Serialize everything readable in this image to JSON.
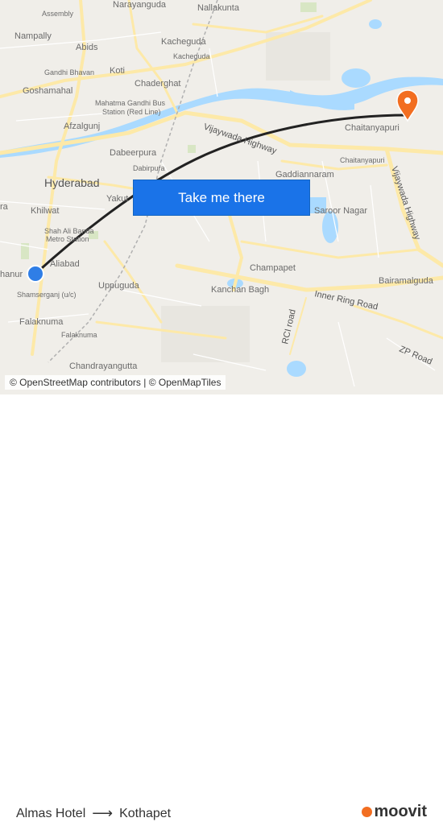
{
  "map": {
    "places": [
      {
        "name": "Assembly",
        "size": "sm"
      },
      {
        "name": "Narayanguda",
        "size": "md"
      },
      {
        "name": "Nallakunta",
        "size": "md"
      },
      {
        "name": "Nampally",
        "size": "md"
      },
      {
        "name": "Abids",
        "size": "md"
      },
      {
        "name": "Kacheguda",
        "size": "md"
      },
      {
        "name": "Kacheguda",
        "size": "sm"
      },
      {
        "name": "Gandhi Bhavan",
        "size": "sm"
      },
      {
        "name": "Koti",
        "size": "md"
      },
      {
        "name": "Goshamahal",
        "size": "md"
      },
      {
        "name": "Chaderghat",
        "size": "md"
      },
      {
        "name": "Mahatma Gandhi Bus",
        "size": "sm"
      },
      {
        "name": "Station (Red Line)",
        "size": "sm"
      },
      {
        "name": "Afzalgunj",
        "size": "md"
      },
      {
        "name": "Chaitanyapuri",
        "size": "md"
      },
      {
        "name": "Chaitanyapuri",
        "size": "sm"
      },
      {
        "name": "Dabeerpura",
        "size": "md"
      },
      {
        "name": "Dabirpura",
        "size": "sm"
      },
      {
        "name": "Gaddiannaram",
        "size": "md"
      },
      {
        "name": "Hyderabad",
        "size": "big"
      },
      {
        "name": "Yakut",
        "size": "md"
      },
      {
        "name": "ra",
        "size": "md"
      },
      {
        "name": "Khilwat",
        "size": "md"
      },
      {
        "name": "Saroor Nagar",
        "size": "md"
      },
      {
        "name": "Shah Ali Banda",
        "size": "sm"
      },
      {
        "name": "Metro Station",
        "size": "sm"
      },
      {
        "name": "Aliabad",
        "size": "md"
      },
      {
        "name": "hanur",
        "size": "md"
      },
      {
        "name": "Champapet",
        "size": "md"
      },
      {
        "name": "Uppuguda",
        "size": "md"
      },
      {
        "name": "Kanchan Bagh",
        "size": "md"
      },
      {
        "name": "Bairamalguda",
        "size": "md"
      },
      {
        "name": "Shamserganj (u/c)",
        "size": "sm"
      },
      {
        "name": "Falaknuma",
        "size": "md"
      },
      {
        "name": "Falaknuma",
        "size": "sm"
      },
      {
        "name": "Chandrayangutta",
        "size": "md"
      }
    ],
    "roads": [
      {
        "name": "Vijaywada Highway"
      },
      {
        "name": "Vijaywada Highway"
      },
      {
        "name": "Inner Ring Road"
      },
      {
        "name": "RCI road"
      },
      {
        "name": "ZP Road"
      }
    ],
    "colors": {
      "route": "#222222",
      "origin": "#2f7ee6",
      "destination": "#f26e21",
      "water": "#aadaff",
      "park": "#d8e6c4",
      "road": "#fde9a8"
    }
  },
  "cta": {
    "label": "Take me there"
  },
  "attribution": "© OpenStreetMap contributors | © OpenMapTiles",
  "footer": {
    "origin": "Almas Hotel",
    "arrow_icon": "arrow-right-icon",
    "destination": "Kothapet",
    "brand": "moovit"
  }
}
